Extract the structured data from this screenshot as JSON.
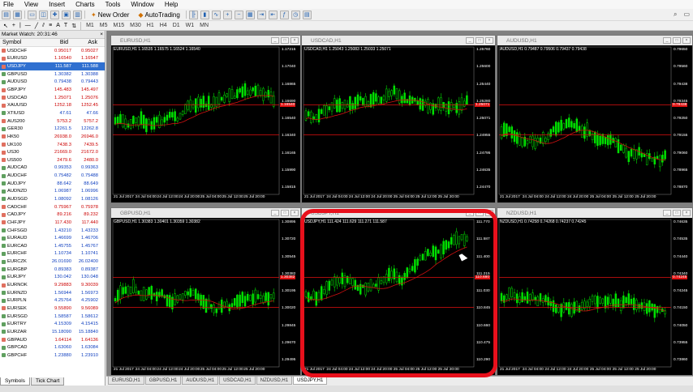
{
  "menu": [
    "File",
    "View",
    "Insert",
    "Charts",
    "Tools",
    "Window",
    "Help"
  ],
  "toolbar": {
    "new_order": "New Order",
    "autotrading": "AutoTrading",
    "timeframes": [
      "M1",
      "M5",
      "M15",
      "M30",
      "H1",
      "H4",
      "D1",
      "W1",
      "MN"
    ]
  },
  "market_watch": {
    "title": "Market Watch: 20:31:46",
    "headers": {
      "symbol": "Symbol",
      "bid": "Bid",
      "ask": "Ask"
    },
    "rows": [
      {
        "symbol": "USDCHF",
        "bid": "0.95017",
        "ask": "0.95027",
        "dir": "dn"
      },
      {
        "symbol": "EURUSD",
        "bid": "1.16540",
        "ask": "1.16547",
        "dir": "dn"
      },
      {
        "symbol": "USDJPY",
        "bid": "111.587",
        "ask": "111.588",
        "dir": "sel"
      },
      {
        "symbol": "GBPUSD",
        "bid": "1.30382",
        "ask": "1.30388",
        "dir": "up"
      },
      {
        "symbol": "AUDUSD",
        "bid": "0.79438",
        "ask": "0.79443",
        "dir": "up"
      },
      {
        "symbol": "GBPJPY",
        "bid": "145.483",
        "ask": "145.497",
        "dir": "dn"
      },
      {
        "symbol": "USDCAD",
        "bid": "1.25071",
        "ask": "1.25076",
        "dir": "dn"
      },
      {
        "symbol": "XAUUSD",
        "bid": "1252.18",
        "ask": "1252.45",
        "dir": "dn"
      },
      {
        "symbol": "XTIUSD",
        "bid": "47.61",
        "ask": "47.66",
        "dir": "up"
      },
      {
        "symbol": "AUS200",
        "bid": "5753.2",
        "ask": "5757.2",
        "dir": "dn"
      },
      {
        "symbol": "GER30",
        "bid": "12261.5",
        "ask": "12262.8",
        "dir": "up"
      },
      {
        "symbol": "HK50",
        "bid": "26938.0",
        "ask": "26946.0",
        "dir": "dn"
      },
      {
        "symbol": "UK100",
        "bid": "7438.3",
        "ask": "7439.5",
        "dir": "dn"
      },
      {
        "symbol": "US30",
        "bid": "21669.0",
        "ask": "21672.0",
        "dir": "dn"
      },
      {
        "symbol": "US500",
        "bid": "2479.6",
        "ask": "2480.0",
        "dir": "dn"
      },
      {
        "symbol": "AUDCAD",
        "bid": "0.99353",
        "ask": "0.99363",
        "dir": "up"
      },
      {
        "symbol": "AUDCHF",
        "bid": "0.75482",
        "ask": "0.75488",
        "dir": "up"
      },
      {
        "symbol": "AUDJPY",
        "bid": "88.642",
        "ask": "88.649",
        "dir": "up"
      },
      {
        "symbol": "AUDNZD",
        "bid": "1.06987",
        "ask": "1.06996",
        "dir": "up"
      },
      {
        "symbol": "AUDSGD",
        "bid": "1.08092",
        "ask": "1.08126",
        "dir": "up"
      },
      {
        "symbol": "CADCHF",
        "bid": "0.75967",
        "ask": "0.75978",
        "dir": "dn"
      },
      {
        "symbol": "CADJPY",
        "bid": "89.216",
        "ask": "89.232",
        "dir": "dn"
      },
      {
        "symbol": "CHFJPY",
        "bid": "117.430",
        "ask": "117.440",
        "dir": "dn"
      },
      {
        "symbol": "CHFSGD",
        "bid": "1.43210",
        "ask": "1.43233",
        "dir": "up"
      },
      {
        "symbol": "EURAUD",
        "bid": "1.46699",
        "ask": "1.46706",
        "dir": "up"
      },
      {
        "symbol": "EURCAD",
        "bid": "1.45755",
        "ask": "1.45767",
        "dir": "up"
      },
      {
        "symbol": "EURCHF",
        "bid": "1.10734",
        "ask": "1.10741",
        "dir": "up"
      },
      {
        "symbol": "EURCZK",
        "bid": "26.01690",
        "ask": "26.02400",
        "dir": "up"
      },
      {
        "symbol": "EURGBP",
        "bid": "0.89383",
        "ask": "0.89387",
        "dir": "up"
      },
      {
        "symbol": "EURJPY",
        "bid": "130.042",
        "ask": "130.048",
        "dir": "up"
      },
      {
        "symbol": "EURNOK",
        "bid": "9.29883",
        "ask": "9.30039",
        "dir": "dn"
      },
      {
        "symbol": "EURNZD",
        "bid": "1.56944",
        "ask": "1.56973",
        "dir": "up"
      },
      {
        "symbol": "EURPLN",
        "bid": "4.25764",
        "ask": "4.25902",
        "dir": "up"
      },
      {
        "symbol": "EURSEK",
        "bid": "9.55890",
        "ask": "9.56089",
        "dir": "dn"
      },
      {
        "symbol": "EURSGD",
        "bid": "1.58587",
        "ask": "1.58612",
        "dir": "up"
      },
      {
        "symbol": "EURTRY",
        "bid": "4.15309",
        "ask": "4.15415",
        "dir": "up"
      },
      {
        "symbol": "EURZAR",
        "bid": "15.18090",
        "ask": "15.18840",
        "dir": "up"
      },
      {
        "symbol": "GBPAUD",
        "bid": "1.64114",
        "ask": "1.64136",
        "dir": "dn"
      },
      {
        "symbol": "GBPCAD",
        "bid": "1.63060",
        "ask": "1.63084",
        "dir": "up"
      },
      {
        "symbol": "GBPCHF",
        "bid": "1.23880",
        "ask": "1.23910",
        "dir": "up"
      }
    ],
    "tabs": [
      "Symbols",
      "Tick Chart"
    ]
  },
  "charts": [
    {
      "name": "eurusd",
      "title": "EURUSD,H1",
      "info": "EURUSD,H1  1.16535 1.16575 1.16524 1.16540",
      "prices": [
        "1.17215",
        "1.17040",
        "1.16865",
        "1.16690",
        "1.16540",
        "1.16340",
        "1.16165",
        "1.15990",
        "1.15815"
      ],
      "times": [
        "21 Jul 2017",
        "24 Jul 04:00",
        "24 Jul 12:00",
        "24 Jul 20:00",
        "25 Jul 04:00",
        "25 Jul 12:00",
        "25 Jul 20:00"
      ],
      "red_label": "1.16540"
    },
    {
      "name": "usdcad",
      "title": "USDCAD,H1",
      "info": "USDCAD,H1  1.25043 1.25083 1.25033 1.25071",
      "prices": [
        "1.25760",
        "1.25600",
        "1.25440",
        "1.25280",
        "1.25071",
        "1.24955",
        "1.24795",
        "1.24635",
        "1.24470"
      ],
      "times": [
        "21 Jul 2017",
        "24 Jul 04:00",
        "24 Jul 12:00",
        "24 Jul 20:00",
        "25 Jul 04:00",
        "25 Jul 12:00",
        "25 Jul 20:00"
      ],
      "red_label": "1.25071"
    },
    {
      "name": "audusd",
      "title": "AUDUSD,H1",
      "info": "AUDUSD,H1  0.79487 0.79506 0.79437 0.79438",
      "prices": [
        "0.79650",
        "0.79560",
        "0.79438",
        "0.79345",
        "0.79250",
        "0.79155",
        "0.79060",
        "0.78965",
        "0.78870"
      ],
      "times": [
        "21 Jul 2017",
        "24 Jul 04:00",
        "24 Jul 12:00",
        "24 Jul 20:00",
        "25 Jul 04:00",
        "25 Jul 12:00",
        "25 Jul 20:00"
      ],
      "red_label": "0.79438"
    },
    {
      "name": "gbpusd",
      "title": "GBPUSD,H1",
      "info": "GBPUSD,H1  1.30383 1.30401 1.30359 1.30382",
      "prices": [
        "1.30895",
        "1.30720",
        "1.30545",
        "1.30382",
        "1.30195",
        "1.30020",
        "1.29845",
        "1.29670",
        "1.29495"
      ],
      "times": [
        "21 Jul 2017",
        "24 Jul 04:00",
        "24 Jul 12:00",
        "24 Jul 20:00",
        "25 Jul 04:00",
        "25 Jul 12:00",
        "25 Jul 20:00"
      ],
      "red_label": "1.30382"
    },
    {
      "name": "usdjpy",
      "title": "USDJPY,H1",
      "info": "USDJPY,H1  111.424 111.629 111.271 111.587",
      "prices": [
        "111.770",
        "111.587",
        "111.400",
        "111.215",
        "111.030",
        "110.845",
        "110.660",
        "110.475",
        "110.290"
      ],
      "times": [
        "21 Jul 2017",
        "24 Jul 04:00",
        "24 Jul 12:00",
        "24 Jul 20:00",
        "25 Jul 04:00",
        "25 Jul 12:00",
        "25 Jul 20:00"
      ],
      "red_label": "110.680"
    },
    {
      "name": "nzdusd",
      "title": "NZDUSD,H1",
      "info": "NZDUSD,H1  0.74258 0.74268 0.74237 0.74245",
      "prices": [
        "0.74635",
        "0.74535",
        "0.74440",
        "0.74340",
        "0.74245",
        "0.74150",
        "0.74050",
        "0.73955",
        "0.73860"
      ],
      "times": [
        "21 Jul 2017",
        "24 Jul 04:00",
        "24 Jul 12:00",
        "24 Jul 20:00",
        "25 Jul 04:00",
        "25 Jul 12:00",
        "25 Jul 20:00"
      ],
      "red_label": "0.74245"
    }
  ],
  "chart_tabs": [
    "EURUSD,H1",
    "GBPUSD,H1",
    "AUDUSD,H1",
    "USDCAD,H1",
    "NZDUSD,H1",
    "USDJPY,H1"
  ],
  "colors": {
    "bull": "#00e000",
    "ma": "#d01010",
    "bg": "#000000",
    "highlight": "#e8101c"
  }
}
